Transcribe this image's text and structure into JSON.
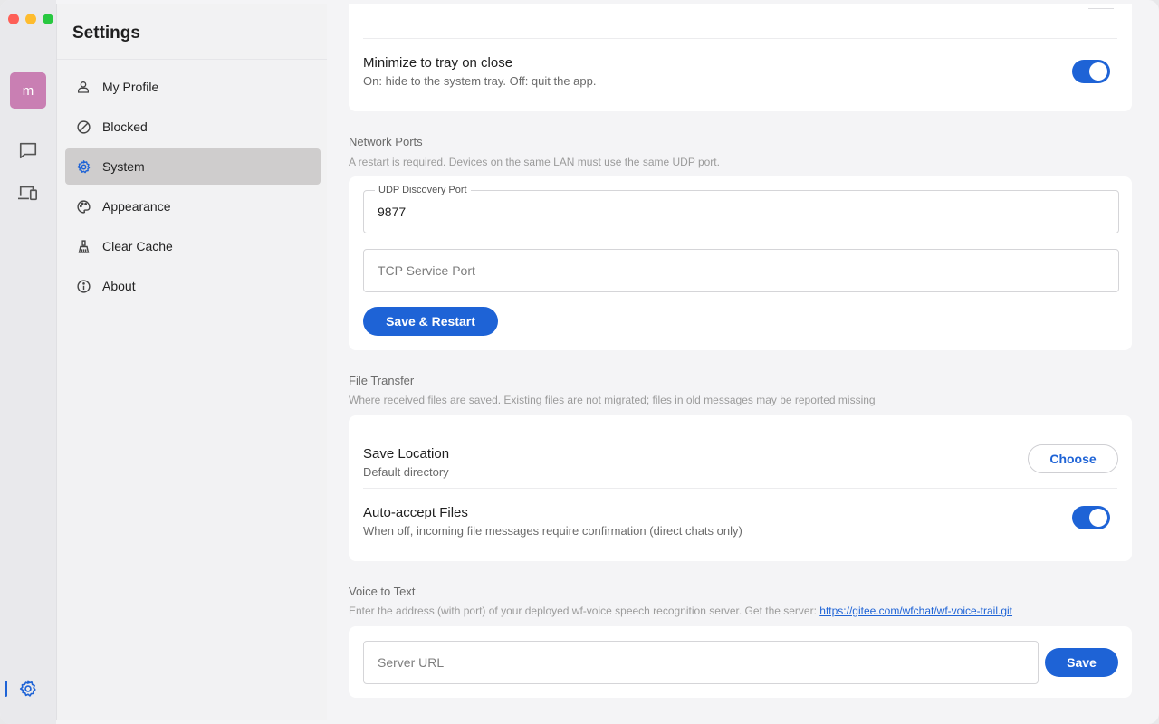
{
  "window": {
    "title": "Settings"
  },
  "rail": {
    "avatar_letter": "m",
    "items": [
      {
        "icon": "chat-icon"
      },
      {
        "icon": "devices-icon"
      },
      {
        "icon": "gear-icon"
      }
    ]
  },
  "nav": {
    "title": "Settings",
    "items": [
      {
        "label": "My Profile",
        "icon": "person-icon"
      },
      {
        "label": "Blocked",
        "icon": "block-icon"
      },
      {
        "label": "System",
        "icon": "gear-icon",
        "active": true
      },
      {
        "label": "Appearance",
        "icon": "palette-icon"
      },
      {
        "label": "Clear Cache",
        "icon": "broom-icon"
      },
      {
        "label": "About",
        "icon": "info-icon"
      }
    ]
  },
  "tray": {
    "title": "Minimize to tray on close",
    "description": "On: hide to the system tray. Off: quit the app.",
    "enabled": true
  },
  "network": {
    "title": "Network Ports",
    "description": "A restart is required. Devices on the same LAN must use the same UDP port.",
    "udp_label": "UDP Discovery Port",
    "udp_value": "9877",
    "tcp_placeholder": "TCP Service Port",
    "save_label": "Save & Restart"
  },
  "file_transfer": {
    "title": "File Transfer",
    "description": "Where received files are saved. Existing files are not migrated; files in old messages may be reported missing",
    "location_title": "Save Location",
    "location_value": "Default directory",
    "choose_label": "Choose",
    "auto_accept_title": "Auto-accept Files",
    "auto_accept_description": "When off, incoming file messages require confirmation (direct chats only)",
    "auto_accept_enabled": true
  },
  "voice": {
    "title": "Voice to Text",
    "description": "Enter the address (with port) of your deployed wf-voice speech recognition server. Get the server: ",
    "link": "https://gitee.com/wfchat/wf-voice-trail.git",
    "url_placeholder": "Server URL",
    "save_label": "Save"
  },
  "colors": {
    "accent": "#1e63d6",
    "avatar": "#c97fb3",
    "active_nav": "#cfcdcd"
  }
}
